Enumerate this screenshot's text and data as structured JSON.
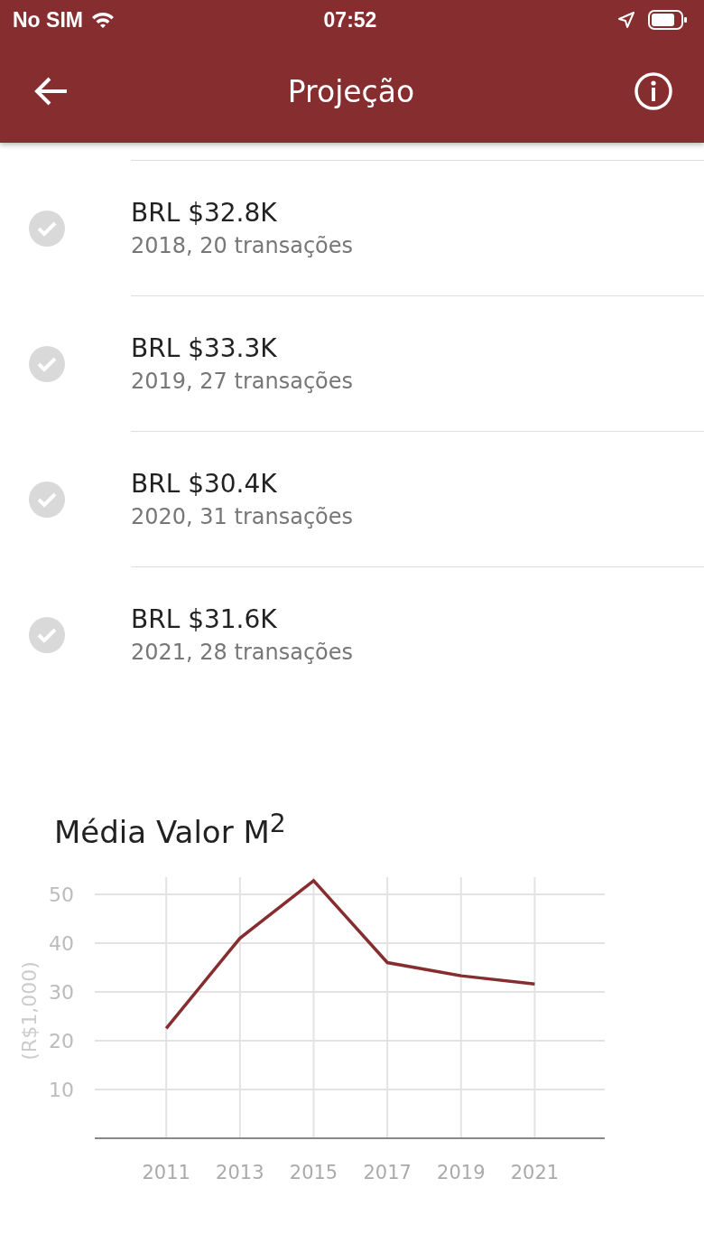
{
  "status_bar": {
    "carrier": "No SIM",
    "time": "07:52"
  },
  "header": {
    "title": "Projeção"
  },
  "transactions": [
    {
      "amount": "BRL $32.8K",
      "detail": "2018, 20 transações",
      "checked": true
    },
    {
      "amount": "BRL $33.3K",
      "detail": "2019, 27 transações",
      "checked": true
    },
    {
      "amount": "BRL $30.4K",
      "detail": "2020, 31 transações",
      "checked": true
    },
    {
      "amount": "BRL $31.6K",
      "detail": "2021, 28 transações",
      "checked": true
    }
  ],
  "chart": {
    "title": "Média Valor M$^{2}$",
    "chart_data": {
      "type": "line",
      "ylabel": "(R$1,000)",
      "x": [
        2011,
        2013,
        2015,
        2017,
        2019,
        2021
      ],
      "grid": true,
      "series": [
        {
          "color": "#862d2f",
          "values": [
            22.5,
            41,
            52.8,
            36,
            33.3,
            31.6
          ]
        }
      ],
      "xlim": [
        2009.06,
        2022.9
      ],
      "ylim": [
        0,
        53.5
      ],
      "xticks": [
        2011,
        2013,
        2015,
        2017,
        2019,
        2021
      ],
      "yticks": [
        10,
        20,
        30,
        40,
        50
      ]
    }
  }
}
